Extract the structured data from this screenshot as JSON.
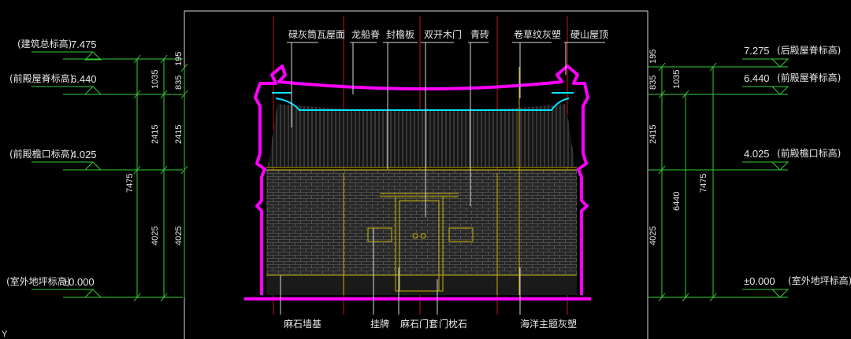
{
  "top_labels": [
    "碌灰筒瓦屋面",
    "龙船脊",
    "封檐板",
    "双开木门",
    "青砖",
    "卷草纹灰塑",
    "硬山屋顶"
  ],
  "bottom_labels": [
    "麻石墙基",
    "挂牌",
    "麻石门套",
    "门枕石",
    "海洋主题灰塑"
  ],
  "left_levels": [
    {
      "text": "(建筑总标高)",
      "value": "7.475"
    },
    {
      "text": "(前殿屋脊标高)",
      "value": "6.440"
    },
    {
      "text": "(前殿檐口标高)",
      "value": "4.025"
    },
    {
      "text": "(室外地坪标高)",
      "value": "±0.000"
    }
  ],
  "right_levels": [
    {
      "text": "(后殿屋脊标高)",
      "value": "7.275"
    },
    {
      "text": "(前殿屋脊标高)",
      "value": "6.440"
    },
    {
      "text": "(前殿檐口标高)",
      "value": "4.025"
    },
    {
      "text": "(室外地坪标高)",
      "value": "±0.000"
    }
  ],
  "left_dims": {
    "outer_total": "7475",
    "outer_upper": "2415",
    "outer_lower": "4025",
    "outer_top": "1035",
    "inner_top_a": "195",
    "inner_top_b": "835",
    "inner_upper": "2415",
    "inner_lower": "4025"
  },
  "right_dims": {
    "inner_top_a": "195",
    "inner_top_b": "835",
    "inner_upper": "2415",
    "inner_lower": "4025",
    "mid_top": "1035",
    "mid_total": "6440",
    "outer_total": "7475"
  },
  "corner_mark": "Y",
  "colors": {
    "background": "#000000",
    "outline": "#ff00ff",
    "dimension": "#33cc33",
    "detail": "#c8b400",
    "ornament": "#00e5ff",
    "axis": "#c81414"
  }
}
